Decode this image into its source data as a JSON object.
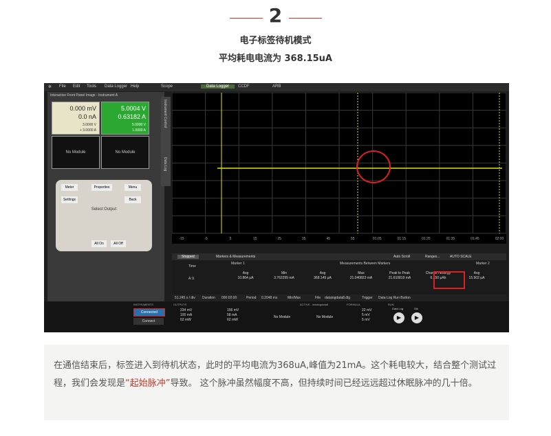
{
  "header": {
    "number": "2",
    "title": "电子标签待机模式",
    "subtitle": "平均耗电电流为 368.15uA"
  },
  "app": {
    "menu": [
      "File",
      "Edit",
      "Tools",
      "Data Logger",
      "Help"
    ],
    "tabs": [
      "Scope",
      "Data Logger",
      "CCDF",
      "ARB"
    ],
    "front_panel_title": "Interactive Front Panel Image - Instrument A",
    "ch1": {
      "voltage": "0.000 mV",
      "current": "0.0 nA",
      "set_v": "3.0000 V",
      "set_i": "+ 3.0000 A"
    },
    "ch2": {
      "voltage": "5.0004 V",
      "current": "0.63182 A",
      "set_v": "5.0000 V",
      "set_i": "1.0000 A"
    },
    "ch3_label": "No Module",
    "ch4_label": "No Module",
    "buttons": [
      "Meter",
      "Properties",
      "Menu",
      "Settings",
      "Back"
    ],
    "select_output_label": "Select Output",
    "all_on": "All On",
    "all_off": "All Off",
    "side_tabs": [
      "Instrument Control",
      "Data Log"
    ],
    "x_ticks": [
      "-15",
      "-5",
      "5",
      "15",
      "25",
      "35",
      "45",
      "55",
      "01:05",
      "01:15",
      "01:25",
      "01:35",
      "01:45",
      "02:00"
    ],
    "marker_left": "1",
    "marker_right": "2",
    "measurements": {
      "tab": "Stopped",
      "title": "Markers & Measurements",
      "auto_scroll": "Auto Scroll",
      "ranges": "Ranges...",
      "auto_scale": "AUTO SCALE",
      "header_between": "Measurements Between Markers",
      "col_time": "Time",
      "col_marker1": "Marker 1",
      "col_marker2": "Marker 2",
      "row_labels": [
        "Avg",
        "Min",
        "Avg",
        "Max",
        "Peak to Peak",
        "Charge / Energy",
        "Avg"
      ],
      "row_values": [
        "10.864 μA",
        "3.762295 mA",
        "368.145 μA",
        "21.040823 mA",
        "21.610819 mA",
        "6.150 μAh",
        "15.902 μA"
      ],
      "row_channel": "A I1"
    },
    "status": {
      "rate": "51.245 s / div",
      "duration_label": "Duration",
      "duration": "000:02:00",
      "period_label": "Period",
      "period": "0.2048 ms",
      "minmax": "Min/Max",
      "file_label": "File",
      "file": "datalogdata8.dlg",
      "trigger_label": "Trigger",
      "trigger": "Data Log Run Button"
    },
    "bottom": {
      "instrument_label": "INSTRUMENTS",
      "connected": "Connected",
      "connect": "Connect",
      "outputs_label": "OUTPUTS",
      "out1": [
        "234 mV",
        "100 mA",
        "62 mW"
      ],
      "out2": [
        "156 mV",
        "58 mA",
        "62 mW"
      ],
      "no_module_1": "No Module",
      "no_module_2": "No Module",
      "active_label": "ACTIVE - datalogdata8",
      "formula_label": "FORMULA",
      "formula_vals": [
        "22 mV",
        "5 mV",
        "5 mV"
      ],
      "run_label": "RUN",
      "run_btn": "Data Log",
      "run_btn2": "Stk"
    }
  },
  "caption": {
    "text_part1": "在通信结束后，标签进入到待机状态，此时的平均电流为368uA,峰值为21mA。这个耗电较大，结合整个测试过程，我们会发现是",
    "highlight": "“起始脉冲”",
    "text_part2": "导致。 这个脉冲虽然幅度不高，但持续时间已经远远超过休眠脉冲的几十倍。"
  },
  "colors": {
    "accent": "#c0392b",
    "trace": "#e6e600",
    "ch1": "#f2f2e0",
    "ch2": "#22aa22"
  }
}
